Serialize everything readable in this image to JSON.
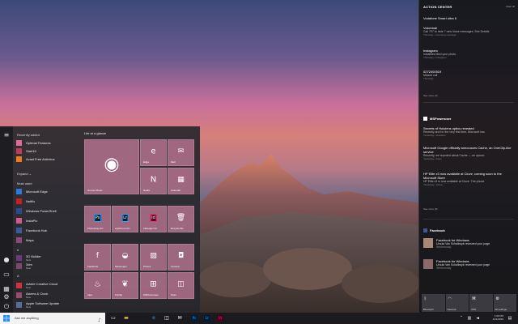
{
  "start_menu": {
    "recently_added_label": "Recently added",
    "expand_label": "Expand ⌄",
    "most_used_label": "Most used",
    "hash_label": "#",
    "a_label": "A",
    "recent_apps": [
      "Optimal Features",
      "Start10",
      "Avast Free Antivirus"
    ],
    "most_used": [
      "Microsoft Edge",
      "Netflix",
      "Windows PowerShell",
      "InstaPic",
      "Facebook Hub",
      "Maps"
    ],
    "hash_apps": [
      {
        "name": "3D Builder",
        "sub": "New"
      },
      {
        "name": "3dm",
        "sub": "New"
      }
    ],
    "a_apps": [
      {
        "name": "Adobe Creative Cloud",
        "sub": "New"
      },
      {
        "name": "Alarms & Clock",
        "sub": "New"
      },
      {
        "name": "Apple Software Update",
        "sub": "New"
      }
    ],
    "tiles_group": "Life at a glance",
    "tiles": {
      "groove": "Groove Music",
      "edge": "Edge",
      "mail": "Mail",
      "netflix": "Netflix",
      "calendar": "Calendar",
      "photoshop": "Photoshop CC",
      "lightroom": "Lightroom CC",
      "indesign": "InDesign CC",
      "recycle": "Recycle Bin",
      "facebook": "Facebook",
      "messenger": "Messenger",
      "photos": "Photos",
      "camera": "Camera",
      "sketch": "Idea",
      "flyclip": "FlyClip",
      "mspowerusers": "MSPoweruser",
      "store": "Store"
    }
  },
  "taskbar": {
    "search_placeholder": "Ask me anything",
    "time": "1:09 PM",
    "date": "2/21/2016"
  },
  "action_center": {
    "title": "ACTION CENTER",
    "clear": "Clear all",
    "group1": [
      {
        "header": "Vodafone Smart ultra 6",
        "body": "",
        "time": ""
      },
      {
        "header": "Voicemail",
        "body": "Call 707 to hear 7 new Voice messages. See Details",
        "time": "Thursday • Incoming message"
      },
      {
        "header": "Instagram",
        "body": "instalikes liked your photo.",
        "time": "Thursday • Instagram"
      },
      {
        "header": "0272000519",
        "body": "Missed call",
        "time": "Thursday"
      }
    ],
    "see_more_1": "See more (3)",
    "mspoweruser_header": "MSPoweruser",
    "ms_items": [
      {
        "header": "Secrets of Hololens optics revealed",
        "body": "Recently and for the very first time, Microsoft has",
        "time": "Yesterday • Hololens"
      },
      {
        "header": "Microsoft Google officially announces Cache, an OneClip-like service",
        "body": "Recently, we reported about Cache — an upcom",
        "time": "Yesterday • Apps"
      },
      {
        "header": "HP Elite x3 now available at Clove, coming soon to the Microsoft Store",
        "body": "HP Elite x3 is now available at Clove. The phone",
        "time": "Yesterday • Clove"
      }
    ],
    "see_more_2": "See more (9)",
    "facebook_header": "Facebook",
    "fb_items": [
      {
        "header": "Facebook for Windows",
        "body": "Ursula Van Schalkwyk reviewed your page",
        "time": "Wednesday"
      },
      {
        "header": "Facebook for Windows",
        "body": "Ursula Van Schalkwyk reviewed your page",
        "time": "Wednesday"
      }
    ],
    "quick_actions": [
      "Bluetooth",
      "Network",
      "VPN",
      "All settings"
    ]
  }
}
